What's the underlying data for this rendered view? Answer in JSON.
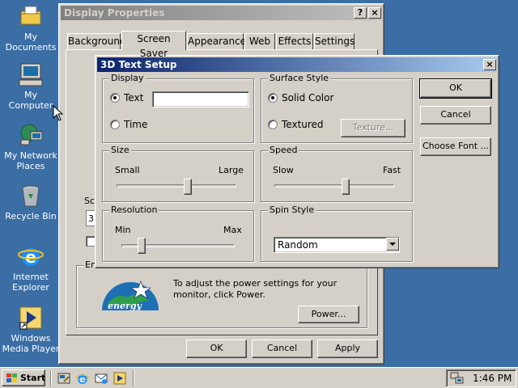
{
  "desktop": {
    "icons": [
      {
        "label": "My Documents"
      },
      {
        "label": "My Computer"
      },
      {
        "label": "My Network Places"
      },
      {
        "label": "Recycle Bin"
      },
      {
        "label": "Internet Explorer"
      },
      {
        "label": "Windows Media Player"
      }
    ]
  },
  "display_properties": {
    "title": "Display Properties",
    "help_glyph": "?",
    "close_glyph": "×",
    "tabs": [
      {
        "label": "Background"
      },
      {
        "label": "Screen Saver"
      },
      {
        "label": "Appearance"
      },
      {
        "label": "Web"
      },
      {
        "label": "Effects"
      },
      {
        "label": "Settings"
      }
    ],
    "screensaver_group_partial": "Sc",
    "screensaver_value_partial": "3I",
    "energy_group_partial": "En",
    "energy_logo_text": "energy",
    "energy_text": "To adjust the power settings for your monitor, click Power.",
    "power_button": "Power...",
    "ok_button": "OK",
    "cancel_button": "Cancel",
    "apply_button": "Apply"
  },
  "setup_dialog": {
    "title": "3D Text Setup",
    "close_glyph": "×",
    "display": {
      "label": "Display",
      "text_option": "Text",
      "text_value": "",
      "time_option": "Time"
    },
    "surface": {
      "label": "Surface Style",
      "solid_option": "Solid Color",
      "textured_option": "Textured",
      "texture_button": "Texture..."
    },
    "size": {
      "label": "Size",
      "min": "Small",
      "max": "Large",
      "level": 0.6
    },
    "speed": {
      "label": "Speed",
      "min": "Slow",
      "max": "Fast",
      "level": 0.6
    },
    "resolution": {
      "label": "Resolution",
      "min": "Min",
      "max": "Max",
      "level": 0.15
    },
    "spin": {
      "label": "Spin Style",
      "selected": "Random"
    },
    "ok_button": "OK",
    "cancel_button": "Cancel",
    "choose_font_button": "Choose Font ..."
  },
  "taskbar": {
    "start_label": "Start",
    "clock": "1:46 PM"
  }
}
